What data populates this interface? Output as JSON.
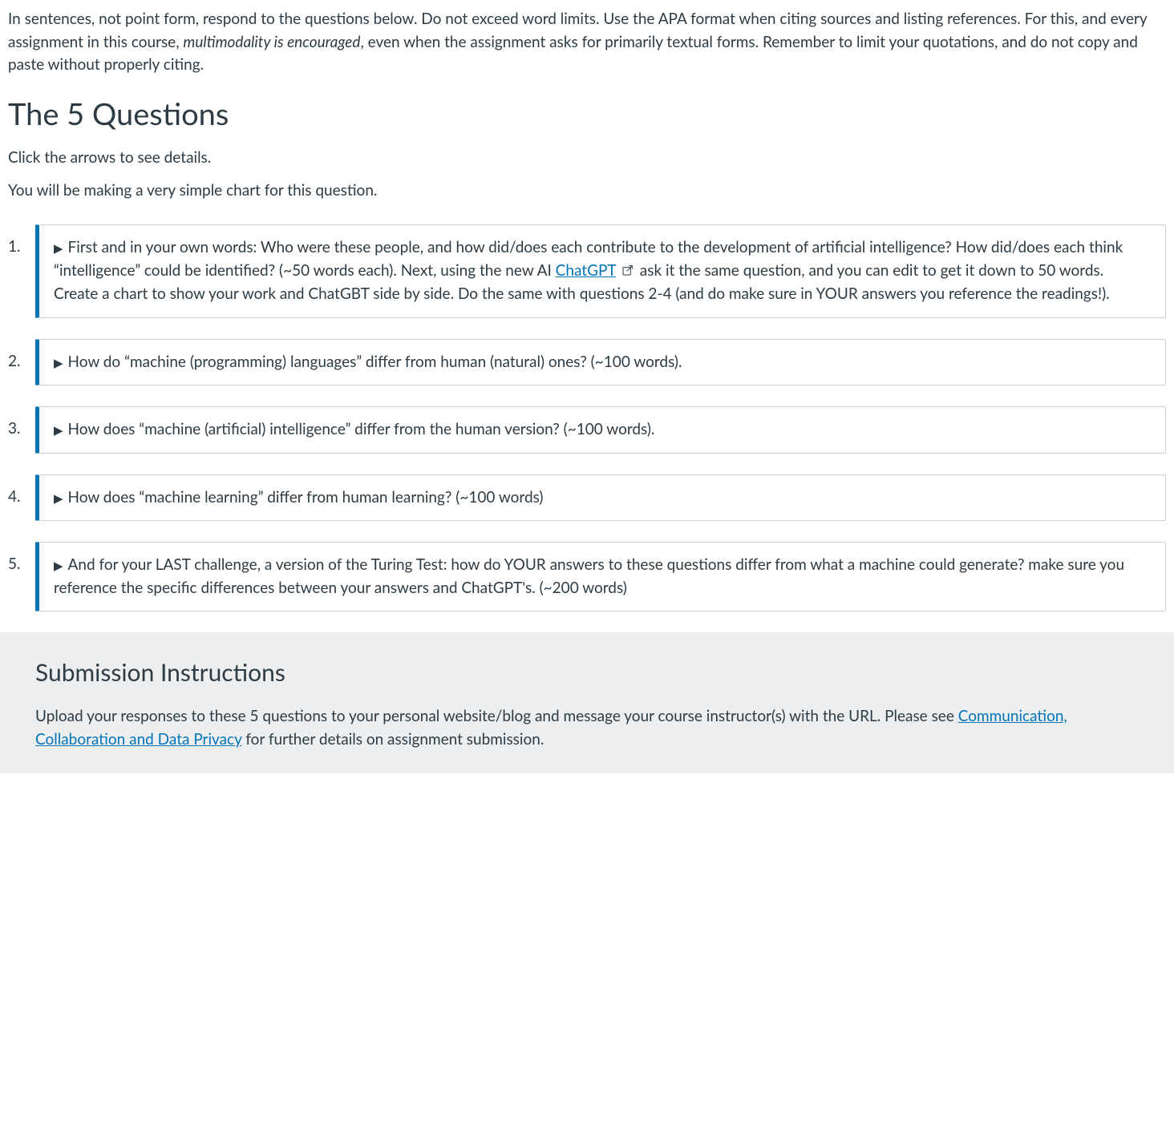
{
  "intro": {
    "text_before_em": "In sentences, not point form, respond to the questions below. Do not exceed word limits. Use the APA format when citing sources and listing references. For this, and every assignment in this course, ",
    "em_text": "multimodality is encouraged",
    "text_after_em": ", even when the assignment asks for primarily textual forms. Remember to limit your quotations, and do not copy and paste without properly citing."
  },
  "heading": "The 5 Questions",
  "sub1": "Click the arrows to see details.",
  "sub2": "You will be making a very simple chart for this question.",
  "questions": {
    "q1": {
      "part1": "First and in your own words:  Who were these people, and how did/does each contribute to the development of artificial intelligence? How did/does each think “intelligence” could be identified? (~50 words each). Next, using the new AI ",
      "link_text": "ChatGPT",
      "part2": " ask it the same question, and you can edit to get it down to 50 words. Create a chart to show your work and ChatGBT side by side. Do the same with questions 2-4 (and do make sure in YOUR answers you reference the readings!)."
    },
    "q2": "How do “machine (programming) languages” differ from human (natural) ones? (~100 words).",
    "q3": "How does “machine (artificial) intelligence” differ from the human version? (~100 words).",
    "q4": "How does “machine learning” differ from human learning? (~100 words)",
    "q5": "And for your LAST challenge, a version of the Turing Test: how do YOUR answers to these questions differ from what a machine could generate? make sure you reference the specific differences between your answers and ChatGPT's. (~200 words)"
  },
  "submission": {
    "heading": "Submission Instructions",
    "text_before_link": "Upload your responses to these 5 questions to your personal website/blog and message your course instructor(s) with the URL. Please see ",
    "link_text": "Communication, Collaboration and Data Privacy",
    "text_after_link": " for further details on assignment submission."
  }
}
